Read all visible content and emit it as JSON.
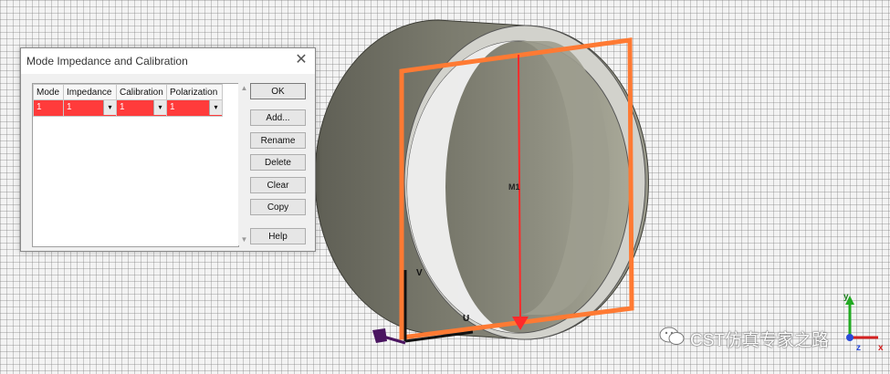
{
  "dialog": {
    "title": "Mode Impedance and Calibration",
    "close_glyph": "✕",
    "table": {
      "headers": [
        "Mode",
        "Impedance",
        "Calibration",
        "Polarization"
      ],
      "rows": [
        {
          "mode": "1",
          "impedance": "1",
          "calibration": "1",
          "polarization": "1"
        }
      ]
    },
    "buttons": {
      "ok": "OK",
      "add": "Add...",
      "rename": "Rename",
      "delete": "Delete",
      "clear": "Clear",
      "copy": "Copy",
      "help": "Help"
    }
  },
  "scene": {
    "port_label": "M1",
    "axis_v": "V",
    "axis_u": "U",
    "triad": {
      "y": "y",
      "z": "z",
      "x": "x"
    }
  },
  "watermark": {
    "text": "CST仿真专家之路"
  },
  "colors": {
    "port_frame": "#ff7a33",
    "port_arrow": "#ff2a2a",
    "selected_row": "#ff3b3b",
    "cylinder": "#8c8c7e"
  }
}
